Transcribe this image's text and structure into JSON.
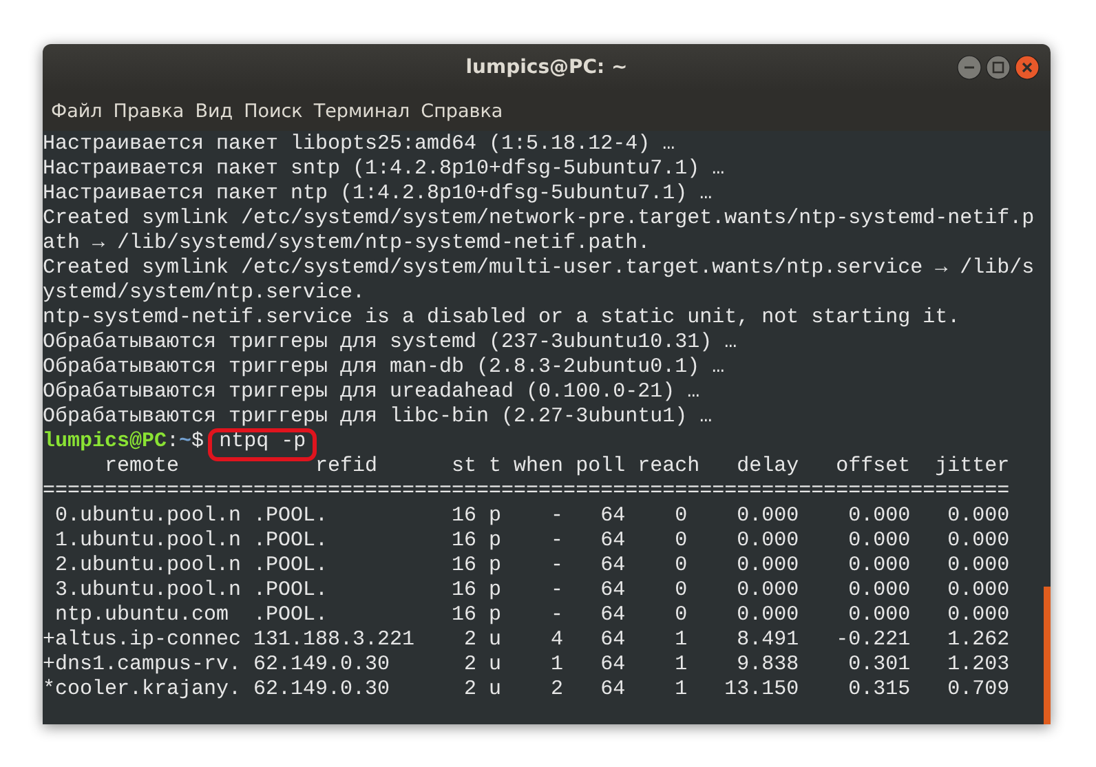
{
  "window": {
    "title": "lumpics@PC: ~"
  },
  "menu": [
    "Файл",
    "Правка",
    "Вид",
    "Поиск",
    "Терминал",
    "Справка"
  ],
  "output": [
    "Настраивается пакет libopts25:amd64 (1:5.18.12-4) …",
    "Настраивается пакет sntp (1:4.2.8p10+dfsg-5ubuntu7.1) …",
    "Настраивается пакет ntp (1:4.2.8p10+dfsg-5ubuntu7.1) …",
    "Created symlink /etc/systemd/system/network-pre.target.wants/ntp-systemd-netif.p",
    "ath → /lib/systemd/system/ntp-systemd-netif.path.",
    "Created symlink /etc/systemd/system/multi-user.target.wants/ntp.service → /lib/s",
    "ystemd/system/ntp.service.",
    "ntp-systemd-netif.service is a disabled or a static unit, not starting it.",
    "Обрабатываются триггеры для systemd (237-3ubuntu10.31) …",
    "Обрабатываются триггеры для man-db (2.8.3-2ubuntu0.1) …",
    "Обрабатываются триггеры для ureadahead (0.100.0-21) …",
    "Обрабатываются триггеры для libc-bin (2.27-3ubuntu1) …"
  ],
  "prompt": {
    "user": "lumpics@PC",
    "separator": ":",
    "path": "~",
    "symbol": "$",
    "command": "ntpq -p",
    "highlighted": true
  },
  "result": [
    "     remote           refid      st t when poll reach   delay   offset  jitter",
    "==============================================================================",
    " 0.ubuntu.pool.n .POOL.          16 p    -   64    0    0.000    0.000   0.000",
    " 1.ubuntu.pool.n .POOL.          16 p    -   64    0    0.000    0.000   0.000",
    " 2.ubuntu.pool.n .POOL.          16 p    -   64    0    0.000    0.000   0.000",
    " 3.ubuntu.pool.n .POOL.          16 p    -   64    0    0.000    0.000   0.000",
    " ntp.ubuntu.com  .POOL.          16 p    -   64    0    0.000    0.000   0.000",
    "+altus.ip-connec 131.188.3.221    2 u    4   64    1    8.491   -0.221   1.262",
    "+dns1.campus-rv. 62.149.0.30      2 u    1   64    1    9.838    0.301   1.203",
    "*cooler.krajany. 62.149.0.30      2 u    2   64    1   13.150    0.315   0.709"
  ]
}
